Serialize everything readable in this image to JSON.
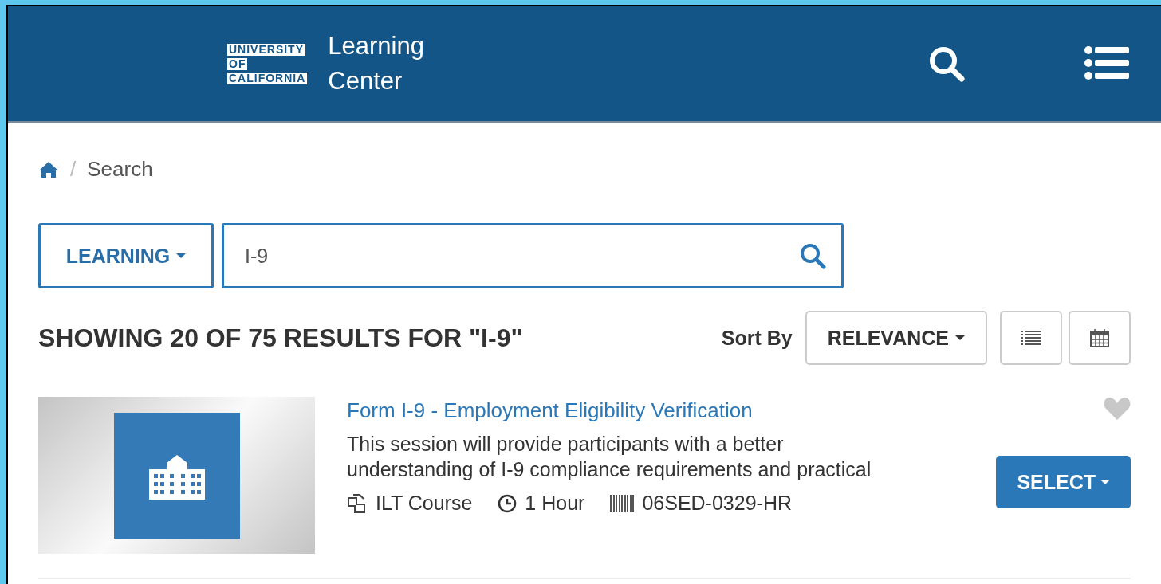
{
  "header": {
    "logo_lines": [
      "UNIVERSITY",
      "OF",
      "CALIFORNIA"
    ],
    "title_lines": [
      "Learning",
      "Center"
    ]
  },
  "breadcrumb": {
    "separator": "/",
    "current": "Search"
  },
  "search": {
    "scope": "LEARNING",
    "value": "I-9"
  },
  "results": {
    "heading": "SHOWING 20 OF 75 RESULTS FOR \"I-9\"",
    "sort_label": "Sort By",
    "sort_value": "RELEVANCE"
  },
  "items": [
    {
      "title": "Form I-9 - Employment Eligibility Verification",
      "description": "This session will provide participants with a better\nunderstanding of I-9 compliance requirements and practical",
      "type": "ILT Course",
      "duration": "1 Hour",
      "code": "06SED-0329-HR",
      "action": "SELECT"
    }
  ]
}
